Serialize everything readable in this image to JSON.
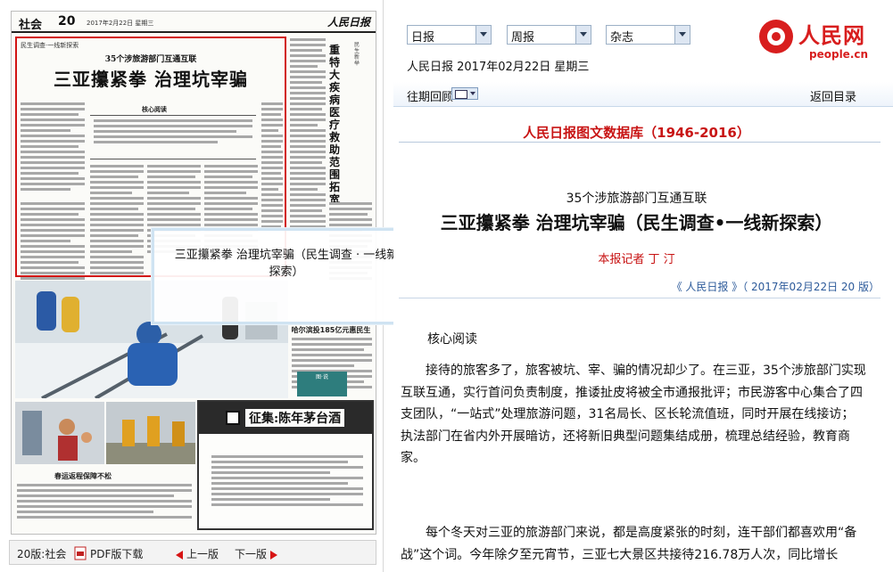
{
  "newspaper": {
    "section": "社会",
    "page_number": "20",
    "date_line": "2017年2月22日 星期三",
    "masthead": "人民日报",
    "article": {
      "tag": "民生调查·一线新探索",
      "subtitle": "35个涉旅游部门互通互联",
      "title": "三亚攥紧拳 治理坑宰骗",
      "core_heading": "核心阅读"
    },
    "side_article": {
      "title": "重特大疾病医疗救助范围拓宽",
      "tag": "民生新举"
    },
    "photo_side_title": "哈尔滨投185亿元惠民生",
    "photo_badge": "图·说",
    "small_photo_caption": "春运返程保障不松",
    "ad_title": "征集:陈年茅台酒"
  },
  "left_bar": {
    "page_label": "20版:社会",
    "pdf_label": "PDF版下载",
    "prev_label": "上一版",
    "next_label": "下一版"
  },
  "popup": {
    "text": "三亚攥紧拳 治理坑宰骗（民生调查 · 一线新探索）"
  },
  "toolbar": {
    "daily": "日报",
    "weekly": "周报",
    "magazine": "杂志",
    "date_line": "人民日报 2017年02月22日 星期三",
    "back_issue": "往期回顾",
    "back_directory": "返回目录"
  },
  "logo": {
    "cn": "人民网",
    "en": "people.cn"
  },
  "database_title": "人民日报图文数据库（1946-2016）",
  "article": {
    "subtitle": "35个涉旅游部门互通互联",
    "title": "三亚攥紧拳 治理坑宰骗（民生调查•一线新探索）",
    "author": "本报记者 丁 汀",
    "source": "《 人民日报 》（ 2017年02月22日 20 版）",
    "core_heading": "核心阅读",
    "paragraph1": "接待的旅客多了，旅客被坑、宰、骗的情况却少了。在三亚，35个涉旅部门实现互联互通，实行首问负责制度，推诿扯皮将被全市通报批评；市民游客中心集合了四支团队，“一站式”处理旅游问题，31名局长、区长轮流值班，同时开展在线接访；执法部门在省内外开展暗访，还将新旧典型问题集结成册，梳理总结经验，教育商家。",
    "paragraph2": "每个冬天对三亚的旅游部门来说，都是高度紧张的时刻，连干部们都喜欢用“备战”这个词。今年除夕至元宵节，三亚七大景区共接待216.78万人次，同比增长"
  },
  "colors": {
    "accent_red": "#c81414",
    "link_blue": "#2c5a9a",
    "band_blue": "#eef4fb"
  }
}
